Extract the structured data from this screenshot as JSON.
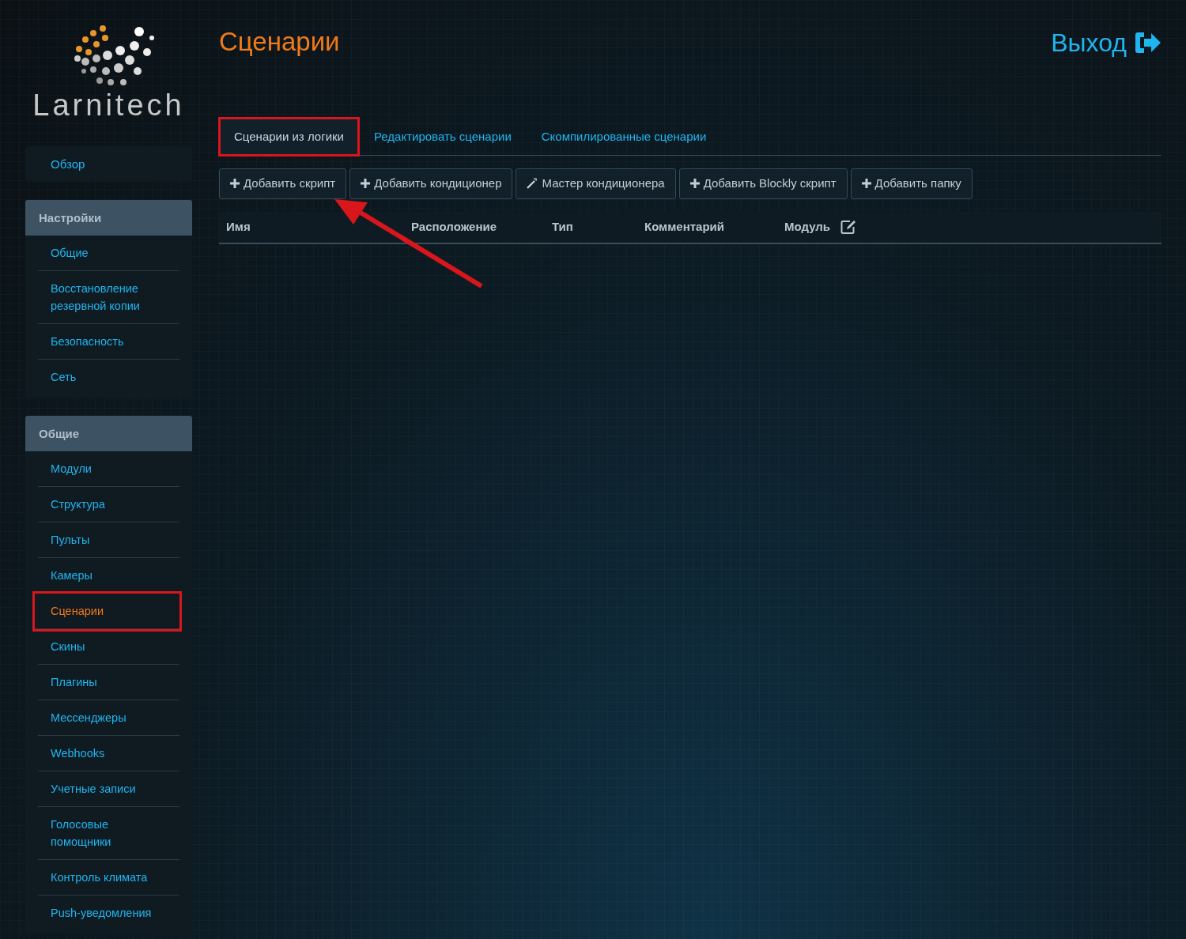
{
  "logo": {
    "text": "Larnitech"
  },
  "page_title": "Сценарии",
  "logout": {
    "label": "Выход"
  },
  "sidebar": {
    "top_item": {
      "label": "Обзор",
      "selected": false
    },
    "groups": [
      {
        "title": "Настройки",
        "items": [
          {
            "label": "Общие",
            "selected": false,
            "highlighted": false
          },
          {
            "label": "Восстановление резервной копии",
            "selected": false,
            "highlighted": false
          },
          {
            "label": "Безопасность",
            "selected": false,
            "highlighted": false
          },
          {
            "label": "Сеть",
            "selected": false,
            "highlighted": false
          }
        ]
      },
      {
        "title": "Общие",
        "items": [
          {
            "label": "Модули",
            "selected": false,
            "highlighted": false
          },
          {
            "label": "Структура",
            "selected": false,
            "highlighted": false
          },
          {
            "label": "Пульты",
            "selected": false,
            "highlighted": false
          },
          {
            "label": "Камеры",
            "selected": false,
            "highlighted": false
          },
          {
            "label": "Сценарии",
            "selected": true,
            "highlighted": true
          },
          {
            "label": "Скины",
            "selected": false,
            "highlighted": false
          },
          {
            "label": "Плагины",
            "selected": false,
            "highlighted": false
          },
          {
            "label": "Мессенджеры",
            "selected": false,
            "highlighted": false
          },
          {
            "label": "Webhooks",
            "selected": false,
            "highlighted": false
          },
          {
            "label": "Учетные записи",
            "selected": false,
            "highlighted": false
          },
          {
            "label": "Голосовые помощники",
            "selected": false,
            "highlighted": false
          },
          {
            "label": "Контроль климата",
            "selected": false,
            "highlighted": false
          },
          {
            "label": "Push-уведомления",
            "selected": false,
            "highlighted": false
          }
        ]
      }
    ]
  },
  "tabs": [
    {
      "label": "Сценарии из логики",
      "selected": true,
      "highlighted": true
    },
    {
      "label": "Редактировать сценарии",
      "selected": false,
      "highlighted": false
    },
    {
      "label": "Скомпилированные сценарии",
      "selected": false,
      "highlighted": false
    }
  ],
  "toolbar": [
    {
      "label": "Добавить скрипт",
      "kind": "plus"
    },
    {
      "label": "Добавить кондиционер",
      "kind": "plus"
    },
    {
      "label": "Мастер кондиционера",
      "kind": "wand"
    },
    {
      "label": "Добавить Blockly скрипт",
      "kind": "plus"
    },
    {
      "label": "Добавить папку",
      "kind": "plus"
    }
  ],
  "table": {
    "columns": [
      "Имя",
      "Расположение",
      "Тип",
      "Комментарий",
      "Модуль"
    ],
    "edit_columns_icon": true
  },
  "callout_arrow": {
    "shown": true
  }
}
